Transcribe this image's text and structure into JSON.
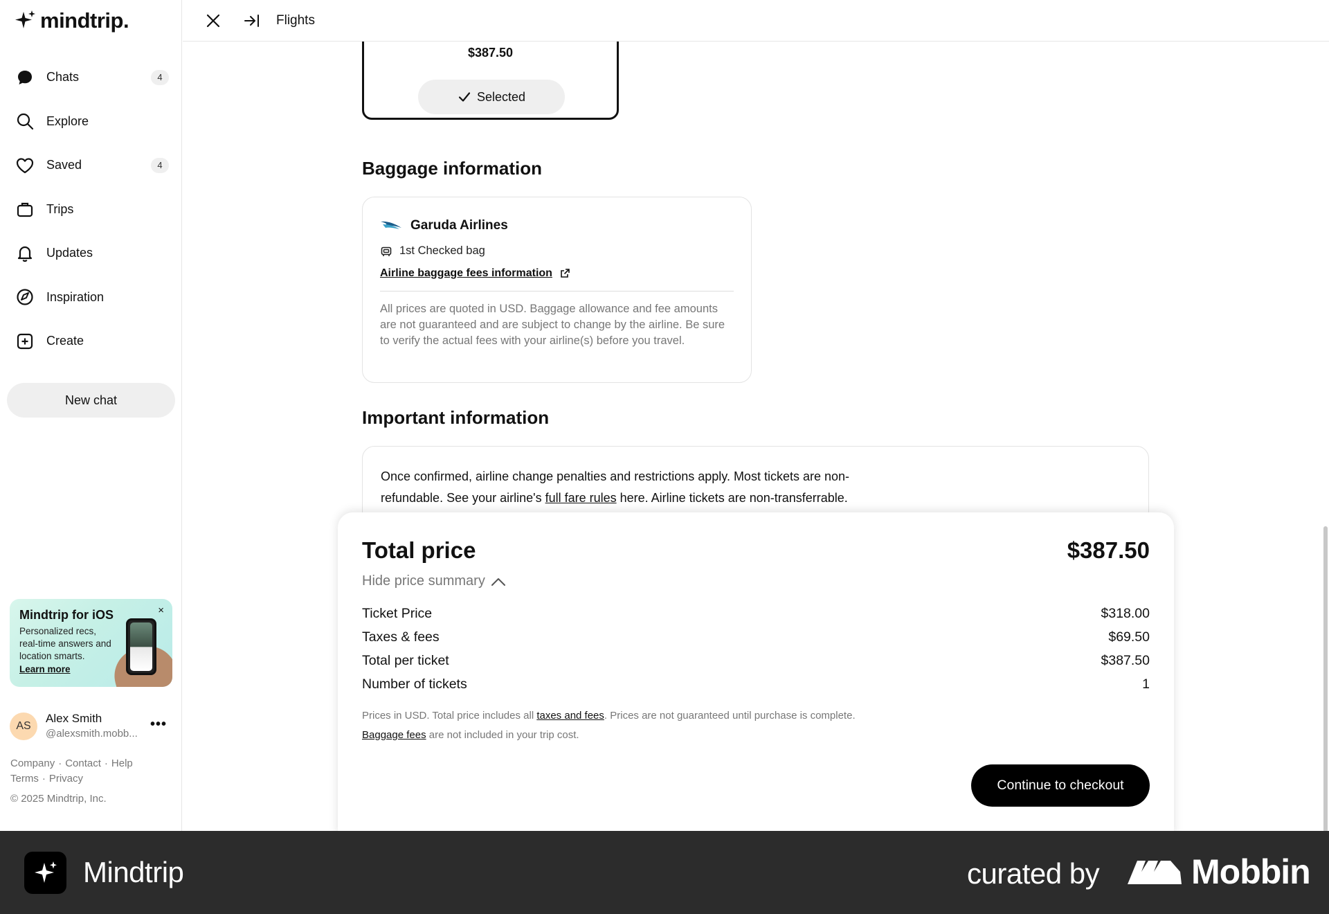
{
  "app": {
    "brand": "mindtrip."
  },
  "sidebar": {
    "items": [
      {
        "label": "Chats",
        "icon": "chat-bubble-icon",
        "badge": "4"
      },
      {
        "label": "Explore",
        "icon": "search-icon",
        "badge": ""
      },
      {
        "label": "Saved",
        "icon": "heart-icon",
        "badge": "4"
      },
      {
        "label": "Trips",
        "icon": "suitcase-icon",
        "badge": ""
      },
      {
        "label": "Updates",
        "icon": "bell-icon",
        "badge": ""
      },
      {
        "label": "Inspiration",
        "icon": "compass-icon",
        "badge": ""
      },
      {
        "label": "Create",
        "icon": "plus-square-icon",
        "badge": ""
      }
    ],
    "new_chat": "New chat",
    "promo": {
      "title": "Mindtrip for iOS",
      "description": "Personalized recs, real-time answers and location smarts.",
      "link": "Learn more",
      "close": "×"
    },
    "user": {
      "initials": "AS",
      "name": "Alex Smith",
      "handle": "@alexsmith.mobb..."
    },
    "footer": {
      "company": "Company",
      "contact": "Contact",
      "help": "Help",
      "terms": "Terms",
      "privacy": "Privacy",
      "copyright": "© 2025 Mindtrip, Inc."
    }
  },
  "topbar": {
    "title": "Flights"
  },
  "fare": {
    "price": "$387.50",
    "selected_label": "Selected"
  },
  "baggage": {
    "heading": "Baggage information",
    "airline": "Garuda Airlines",
    "bag_item": "1st Checked bag",
    "fees_link": "Airline baggage fees information",
    "note": "All prices are quoted in USD. Baggage allowance and fee amounts are not guaranteed and are subject to change by the airline. Be sure to verify the actual fees with your airline(s) before you travel."
  },
  "important": {
    "heading": "Important information",
    "text_before": "Once confirmed, airline change penalties and restrictions apply. Most tickets are non-refundable. See your airline's ",
    "link": "full fare rules",
    "text_after": " here. Airline tickets are non-transferrable."
  },
  "summary": {
    "total_label": "Total price",
    "total_value": "$387.50",
    "toggle": "Hide price summary",
    "rows": [
      {
        "label": "Ticket Price",
        "value": "$318.00"
      },
      {
        "label": "Taxes & fees",
        "value": "$69.50"
      },
      {
        "label": "Total per ticket",
        "value": "$387.50"
      },
      {
        "label": "Number of tickets",
        "value": "1"
      }
    ],
    "fine1_before": "Prices in USD. Total price includes all ",
    "fine1_link": "taxes and fees",
    "fine1_after": ". Prices are not guaranteed until purchase is complete.",
    "fine2_link": "Baggage fees",
    "fine2_after": " are not included in your trip cost.",
    "checkout": "Continue to checkout"
  },
  "brandbar": {
    "app_name": "Mindtrip",
    "curated_by": "curated by",
    "mobbin": "Mobbin"
  }
}
